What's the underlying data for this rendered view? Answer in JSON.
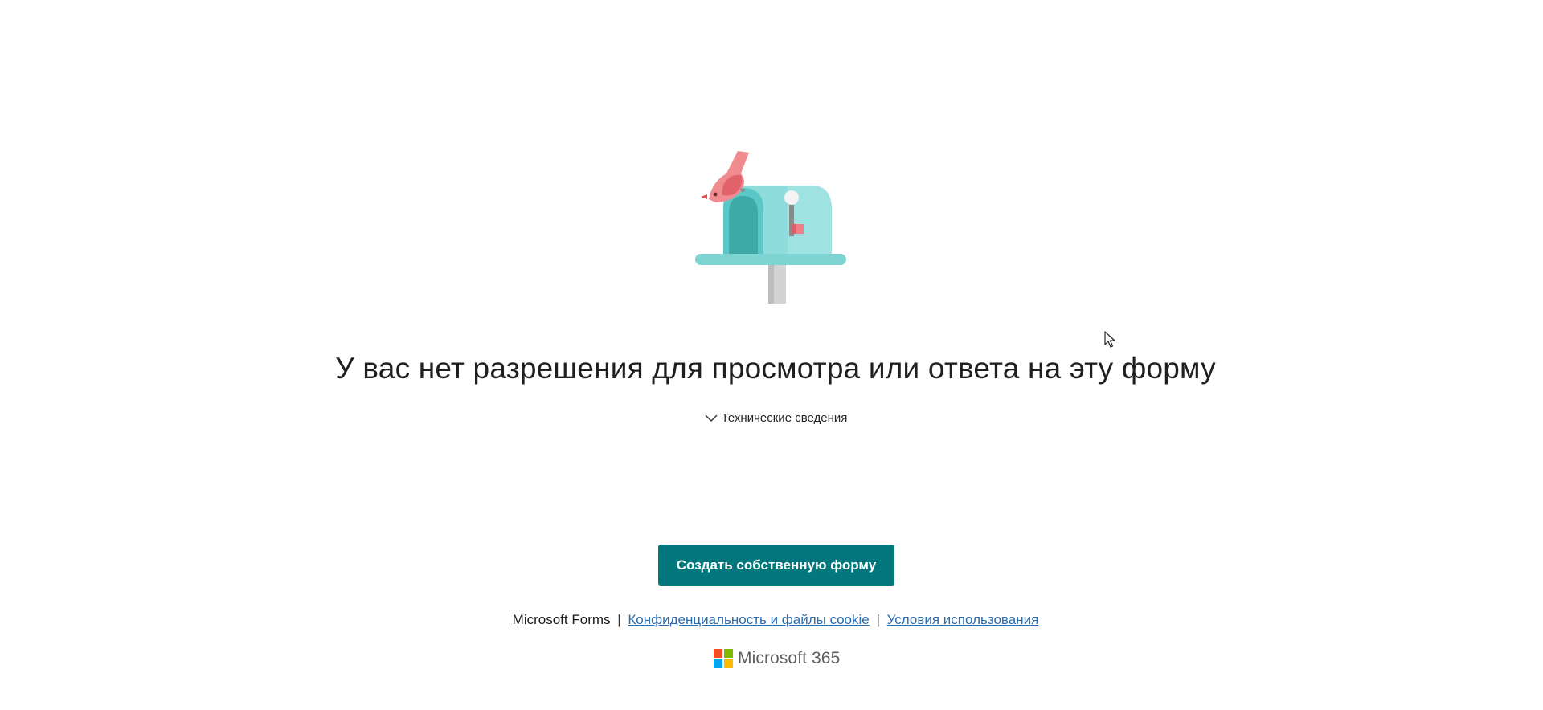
{
  "error": {
    "title": "У вас нет разрешения для просмотра или ответа на эту форму",
    "details_toggle": "Технические сведения"
  },
  "actions": {
    "create_form_label": "Создать собственную форму"
  },
  "footer": {
    "brand": "Microsoft Forms",
    "separator": "|",
    "privacy_link": "Конфиденциальность и файлы cookie",
    "terms_link": "Условия использования"
  },
  "product": {
    "name": "Microsoft 365",
    "logo_colors": [
      "#f25022",
      "#7fba00",
      "#00a4ef",
      "#ffb900"
    ]
  },
  "theme": {
    "button_color": "#03787c",
    "link_color": "#2b6cb0"
  },
  "icons": {
    "illustration": "mailbox-illustration",
    "toggle": "chevron-down-icon",
    "cursor": "mouse-cursor-icon"
  }
}
